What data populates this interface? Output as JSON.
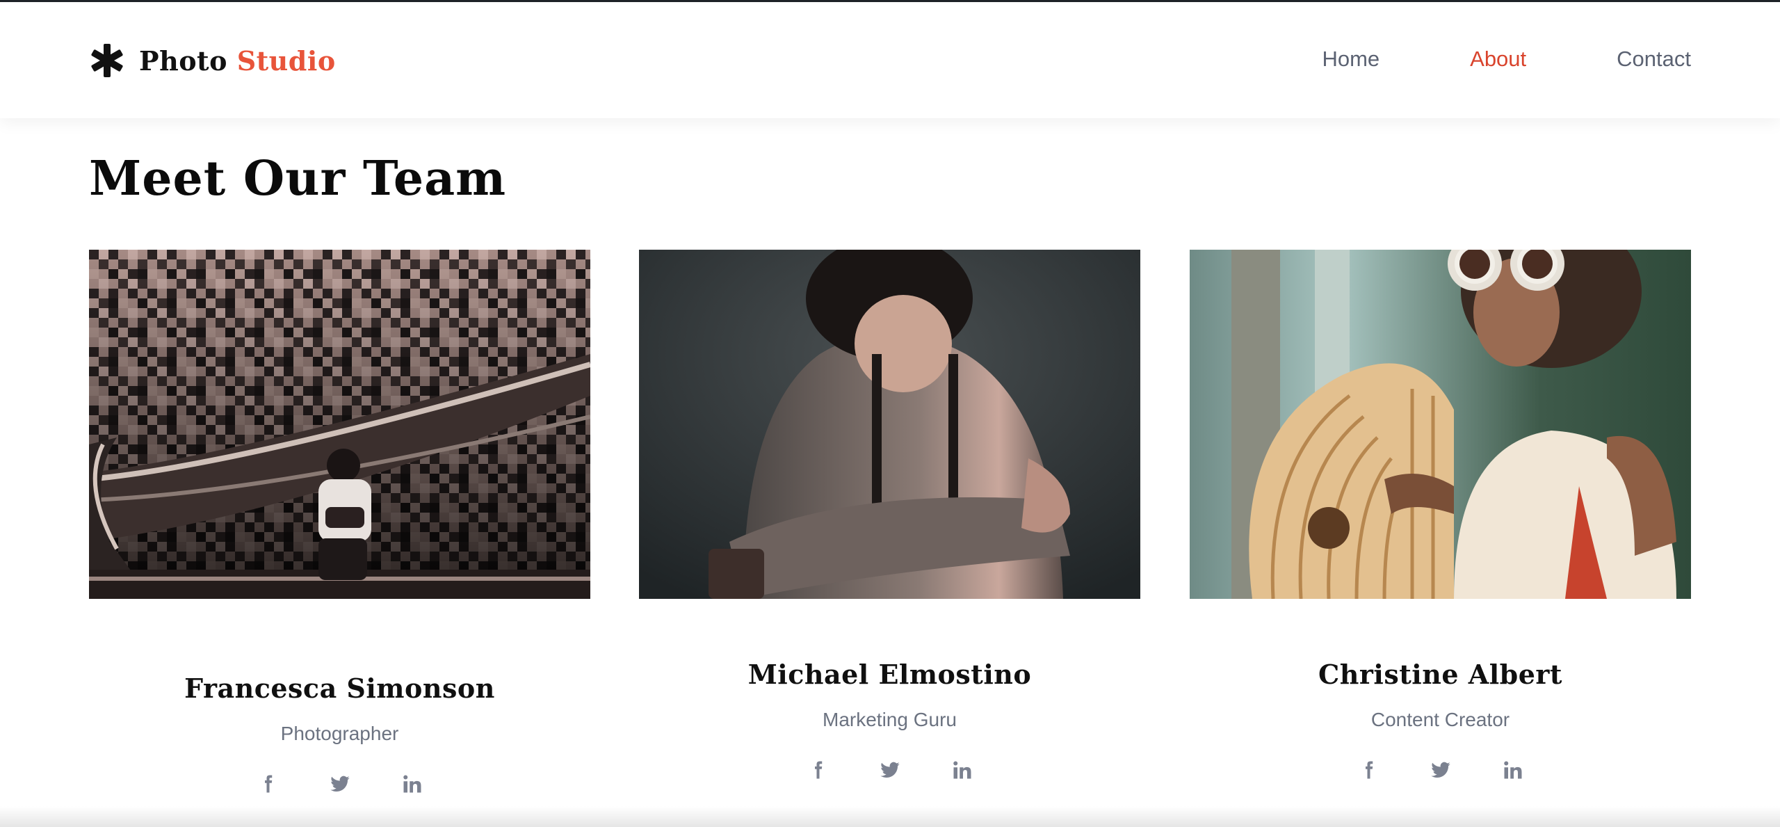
{
  "brand": {
    "name_part1": "Photo",
    "name_part2": "Studio",
    "icon": "asterisk-icon",
    "accent_color": "#e8543a"
  },
  "nav": {
    "items": [
      {
        "label": "Home",
        "active": false
      },
      {
        "label": "About",
        "active": true
      },
      {
        "label": "Contact",
        "active": false
      }
    ],
    "active_color": "#d9442d"
  },
  "page": {
    "title": "Meet Our Team"
  },
  "team": [
    {
      "name": "Francesca Simonson",
      "role": "Photographer",
      "photo": "photographer-on-escalator-photo"
    },
    {
      "name": "Michael Elmostino",
      "role": "Marketing Guru",
      "photo": "man-in-shirt-photo"
    },
    {
      "name": "Christine Albert",
      "role": "Content Creator",
      "photo": "woman-with-bamboo-bag-photo"
    }
  ],
  "social_icons": [
    "facebook-icon",
    "twitter-icon",
    "linkedin-icon"
  ]
}
